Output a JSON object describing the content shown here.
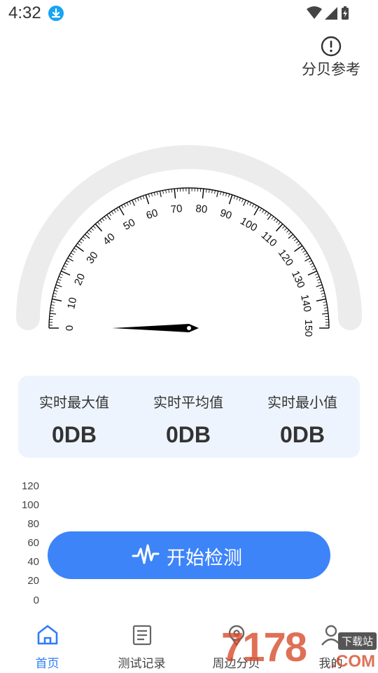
{
  "status_bar": {
    "time": "4:32"
  },
  "header": {
    "reference_label": "分贝参考"
  },
  "gauge": {
    "min": 0,
    "max": 150,
    "major_step": 10,
    "current_value": 0,
    "tick_labels": [
      "0",
      "10",
      "20",
      "30",
      "40",
      "50",
      "60",
      "70",
      "80",
      "90",
      "100",
      "110",
      "120",
      "130",
      "140",
      "150"
    ]
  },
  "stats": {
    "max": {
      "label": "实时最大值",
      "value": "0DB"
    },
    "avg": {
      "label": "实时平均值",
      "value": "0DB"
    },
    "min": {
      "label": "实时最小值",
      "value": "0DB"
    }
  },
  "chart": {
    "y_ticks": [
      "120",
      "100",
      "80",
      "60",
      "40",
      "20",
      "0"
    ]
  },
  "start_button": {
    "label": "开始检测"
  },
  "bottom_nav": {
    "items": [
      {
        "label": "首页",
        "active": true
      },
      {
        "label": "测试记录",
        "active": false
      },
      {
        "label": "周边分贝",
        "active": false
      },
      {
        "label": "我的",
        "active": false
      }
    ]
  },
  "watermark": {
    "digits": "7178",
    "tag": "下载站",
    "suffix": ".COM"
  },
  "colors": {
    "accent": "#3d84f9",
    "nav_active": "#2f7cf6",
    "card_bg": "#eef4fd"
  }
}
